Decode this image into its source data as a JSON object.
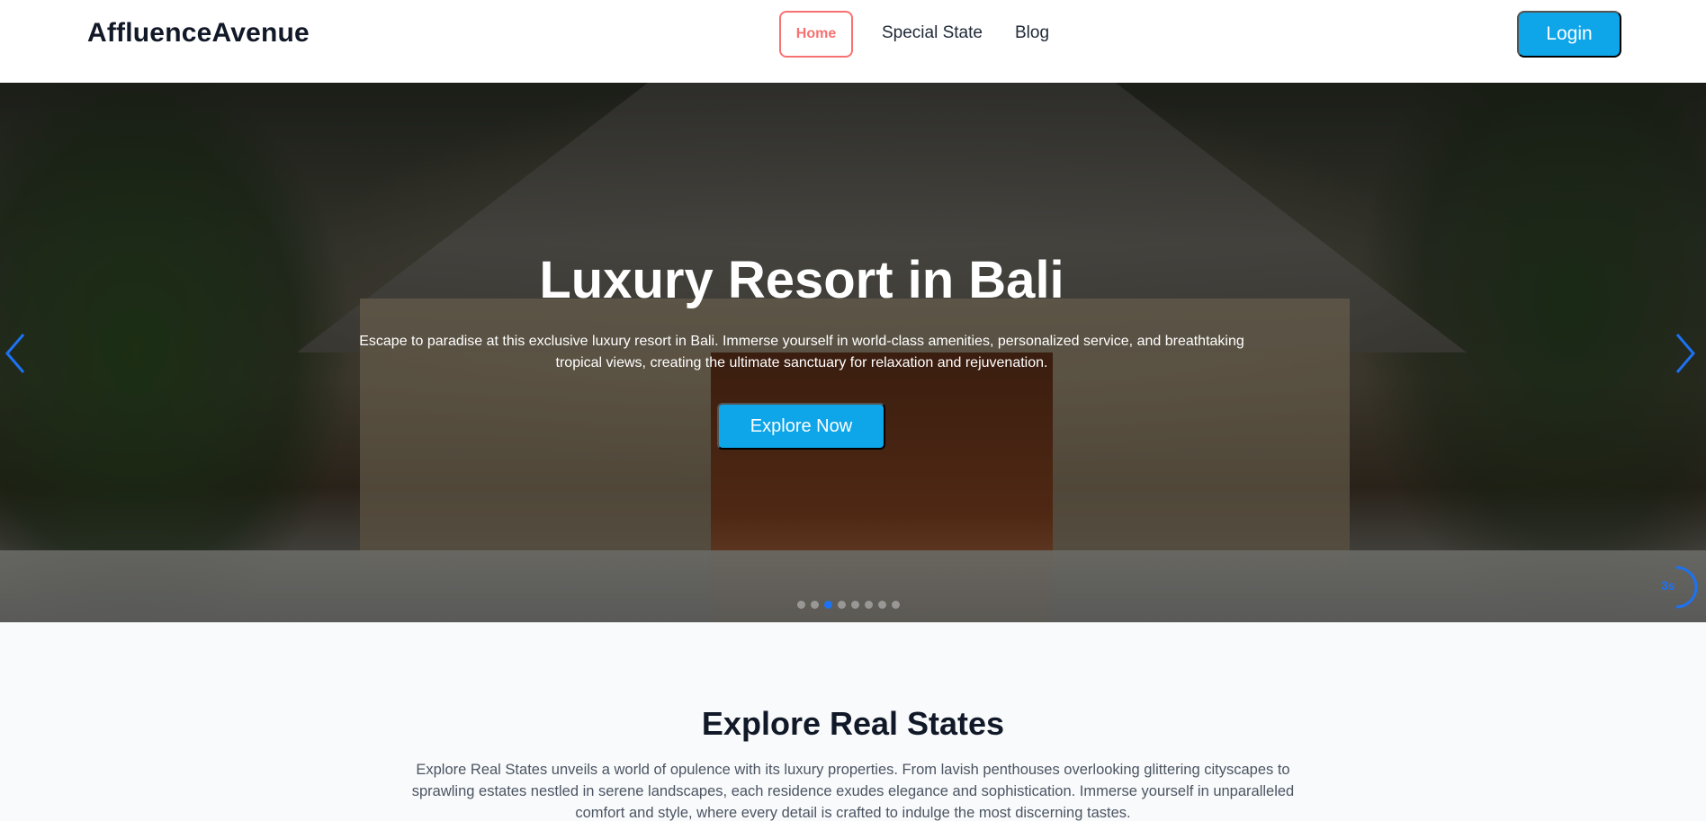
{
  "navbar": {
    "brand": "AffluenceAvenue",
    "links": [
      {
        "label": "Home",
        "active": true
      },
      {
        "label": "Special State",
        "active": false
      },
      {
        "label": "Blog",
        "active": false
      }
    ],
    "login_label": "Login"
  },
  "hero": {
    "title": "Luxury Resort in Bali",
    "description": "Escape to paradise at this exclusive luxury resort in Bali. Immerse yourself in world-class amenities, personalized service, and breathtaking tropical views, creating the ultimate sanctuary for relaxation and rejuvenation.",
    "cta_label": "Explore Now",
    "slide_count": 8,
    "active_slide": 3,
    "autoplay_remaining": "3s",
    "prev_icon": "chevron-left-icon",
    "next_icon": "chevron-right-icon"
  },
  "section": {
    "title": "Explore Real States",
    "description": "Explore Real States unveils a world of opulence with its luxury properties. From lavish penthouses overlooking glittering cityscapes to sprawling estates nestled in serene landscapes, each residence exudes elegance and sophistication. Immerse yourself in unparalleled comfort and style, where every detail is crafted to indulge the most discerning tastes."
  },
  "colors": {
    "accent": "#0ea5e9",
    "active_nav": "#f87171",
    "indicator": "#1d72f3"
  }
}
